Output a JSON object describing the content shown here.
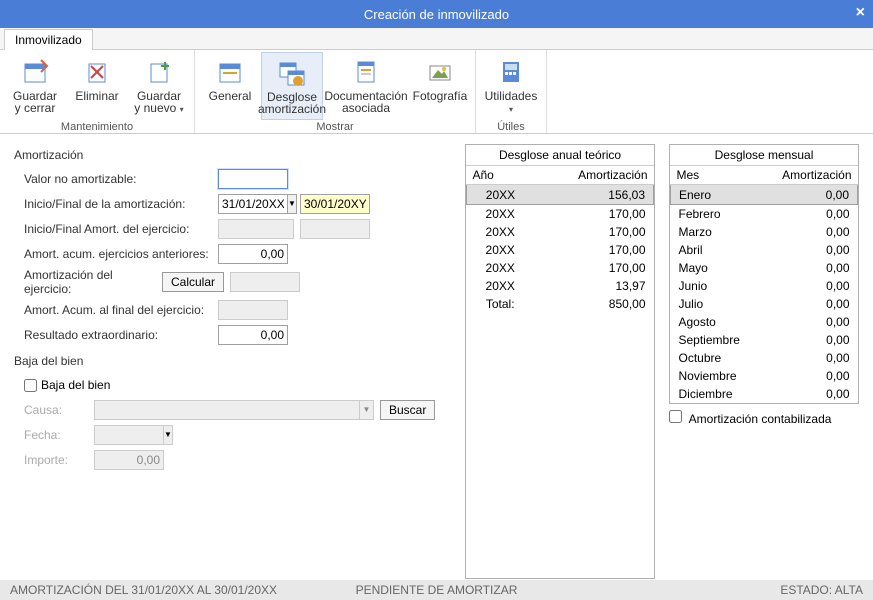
{
  "window": {
    "title": "Creación de inmovilizado"
  },
  "tabs": [
    {
      "label": "Inmovilizado"
    }
  ],
  "ribbon": {
    "groups": [
      {
        "name": "Mantenimiento",
        "buttons": [
          {
            "id": "save-close",
            "label": "Guardar\ny cerrar"
          },
          {
            "id": "delete",
            "label": "Eliminar"
          },
          {
            "id": "save-new",
            "label": "Guardar\ny nuevo",
            "drop": true
          }
        ]
      },
      {
        "name": "Mostrar",
        "buttons": [
          {
            "id": "general",
            "label": "General"
          },
          {
            "id": "desglose",
            "label": "Desglose\namortización",
            "active": true
          },
          {
            "id": "doc",
            "label": "Documentación\nasociada",
            "wide": true
          },
          {
            "id": "foto",
            "label": "Fotografía"
          }
        ]
      },
      {
        "name": "Útiles",
        "buttons": [
          {
            "id": "util",
            "label": "Utilidades",
            "drop": true
          }
        ]
      }
    ]
  },
  "amort": {
    "title": "Amortización",
    "rows": {
      "valor_no_amort": {
        "label": "Valor no amortizable:",
        "value": ""
      },
      "inicio_fin": {
        "label": "Inicio/Final de la amortización:",
        "v1": "31/01/20XX",
        "v2": "30/01/20XY"
      },
      "inicio_fin_ej": {
        "label": "Inicio/Final Amort. del ejercicio:",
        "v1": "",
        "v2": ""
      },
      "acum_ant": {
        "label": "Amort. acum. ejercicios anteriores:",
        "value": "0,00"
      },
      "amort_ej": {
        "label": "Amortización del ejercicio:",
        "btn": "Calcular",
        "value": ""
      },
      "acum_fin": {
        "label": "Amort. Acum. al final del ejercicio:",
        "value": ""
      },
      "res_ext": {
        "label": "Resultado extraordinario:",
        "value": "0,00"
      }
    }
  },
  "baja": {
    "title": "Baja del bien",
    "check": "Baja del bien",
    "causa": {
      "label": "Causa:",
      "btn": "Buscar"
    },
    "fecha": {
      "label": "Fecha:"
    },
    "importe": {
      "label": "Importe:",
      "value": "0,00"
    }
  },
  "annual": {
    "title": "Desglose anual teórico",
    "h1": "Año",
    "h2": "Amortización",
    "rows": [
      {
        "y": "20XX",
        "v": "156,03",
        "sel": true
      },
      {
        "y": "20XX",
        "v": "170,00"
      },
      {
        "y": "20XX",
        "v": "170,00"
      },
      {
        "y": "20XX",
        "v": "170,00"
      },
      {
        "y": "20XX",
        "v": "170,00"
      },
      {
        "y": "20XX",
        "v": "13,97"
      },
      {
        "y": "Total:",
        "v": "850,00"
      }
    ]
  },
  "monthly": {
    "title": "Desglose mensual",
    "h1": "Mes",
    "h2": "Amortización",
    "rows": [
      {
        "m": "Enero",
        "v": "0,00",
        "sel": true
      },
      {
        "m": "Febrero",
        "v": "0,00"
      },
      {
        "m": "Marzo",
        "v": "0,00"
      },
      {
        "m": "Abril",
        "v": "0,00"
      },
      {
        "m": "Mayo",
        "v": "0,00"
      },
      {
        "m": "Junio",
        "v": "0,00"
      },
      {
        "m": "Julio",
        "v": "0,00"
      },
      {
        "m": "Agosto",
        "v": "0,00"
      },
      {
        "m": "Septiembre",
        "v": "0,00"
      },
      {
        "m": "Octubre",
        "v": "0,00"
      },
      {
        "m": "Noviembre",
        "v": "0,00"
      },
      {
        "m": "Diciembre",
        "v": "0,00"
      }
    ],
    "contab": "Amortización contabilizada"
  },
  "status": {
    "left": "AMORTIZACIÓN DEL 31/01/20XX AL 30/01/20XX",
    "center": "PENDIENTE DE AMORTIZAR",
    "right": "ESTADO: ALTA"
  }
}
